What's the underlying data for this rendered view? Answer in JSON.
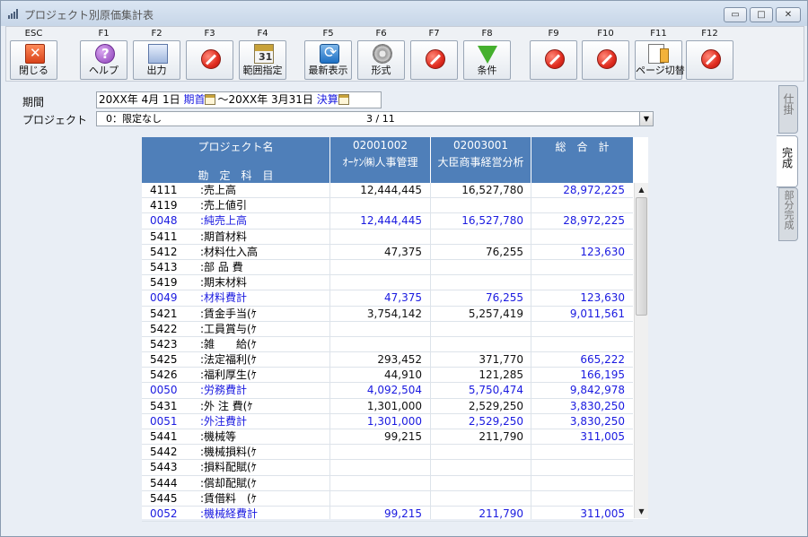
{
  "window": {
    "title": "プロジェクト別原価集計表"
  },
  "window_controls": {
    "minimize": "▭",
    "maximize": "□",
    "close": "✕"
  },
  "toolbar": [
    {
      "key": "ESC",
      "label": "閉じる",
      "icon": "close-icon"
    },
    {
      "key": "F1",
      "label": "ヘルプ",
      "icon": "help-icon"
    },
    {
      "key": "F2",
      "label": "出力",
      "icon": "print-icon"
    },
    {
      "key": "F3",
      "label": "",
      "icon": "stop-icon"
    },
    {
      "key": "F4",
      "label": "範囲指定",
      "icon": "calendar-icon"
    },
    {
      "key": "F5",
      "label": "最新表示",
      "icon": "refresh-icon"
    },
    {
      "key": "F6",
      "label": "形式",
      "icon": "gear-icon"
    },
    {
      "key": "F7",
      "label": "",
      "icon": "stop-icon"
    },
    {
      "key": "F8",
      "label": "条件",
      "icon": "filter-icon"
    },
    {
      "key": "F9",
      "label": "",
      "icon": "stop-icon"
    },
    {
      "key": "F10",
      "label": "",
      "icon": "stop-icon"
    },
    {
      "key": "F11",
      "label": "ページ切替",
      "icon": "page-icon"
    },
    {
      "key": "F12",
      "label": "",
      "icon": "stop-icon"
    }
  ],
  "filters": {
    "period_label": "期間",
    "period_start": "20XX年 4月 1日",
    "period_start_link": "期首",
    "period_sep": "～",
    "period_end": "20XX年 3月31日",
    "period_end_link": "決算",
    "project_label": "プロジェクト",
    "project_value": "0：限定なし",
    "project_count": "3 / 11"
  },
  "grid": {
    "header_name_top": "プロジェクト名",
    "header_name_bottom": "勘　定　科　目",
    "columns": [
      {
        "code": "02001002",
        "name": "ｵｰｹﾝ㈱人事管理"
      },
      {
        "code": "02003001",
        "name": "大臣商事経営分析"
      },
      {
        "code": "総　合　計",
        "name": ""
      }
    ],
    "rows": [
      {
        "code": "4111",
        "name": ":売上高",
        "c1": "12,444,445",
        "c2": "16,527,780",
        "total": "28,972,225",
        "subtotal": false
      },
      {
        "code": "4119",
        "name": ":売上値引",
        "c1": "",
        "c2": "",
        "total": "",
        "subtotal": false
      },
      {
        "code": "0048",
        "name": ":純売上高",
        "c1": "12,444,445",
        "c2": "16,527,780",
        "total": "28,972,225",
        "subtotal": true
      },
      {
        "code": "5411",
        "name": ":期首材料",
        "c1": "",
        "c2": "",
        "total": "",
        "subtotal": false
      },
      {
        "code": "5412",
        "name": ":材料仕入高",
        "c1": "47,375",
        "c2": "76,255",
        "total": "123,630",
        "subtotal": false
      },
      {
        "code": "5413",
        "name": ":部 品 費",
        "c1": "",
        "c2": "",
        "total": "",
        "subtotal": false
      },
      {
        "code": "5419",
        "name": ":期末材料",
        "c1": "",
        "c2": "",
        "total": "",
        "subtotal": false
      },
      {
        "code": "0049",
        "name": ":材料費計",
        "c1": "47,375",
        "c2": "76,255",
        "total": "123,630",
        "subtotal": true
      },
      {
        "code": "5421",
        "name": ":賃金手当(ｹ",
        "c1": "3,754,142",
        "c2": "5,257,419",
        "total": "9,011,561",
        "subtotal": false
      },
      {
        "code": "5422",
        "name": ":工員賞与(ｹ",
        "c1": "",
        "c2": "",
        "total": "",
        "subtotal": false
      },
      {
        "code": "5423",
        "name": ":雑　　給(ｹ",
        "c1": "",
        "c2": "",
        "total": "",
        "subtotal": false
      },
      {
        "code": "5425",
        "name": ":法定福利(ｹ",
        "c1": "293,452",
        "c2": "371,770",
        "total": "665,222",
        "subtotal": false
      },
      {
        "code": "5426",
        "name": ":福利厚生(ｹ",
        "c1": "44,910",
        "c2": "121,285",
        "total": "166,195",
        "subtotal": false
      },
      {
        "code": "0050",
        "name": ":労務費計",
        "c1": "4,092,504",
        "c2": "5,750,474",
        "total": "9,842,978",
        "subtotal": true
      },
      {
        "code": "5431",
        "name": ":外 注 費(ｹ",
        "c1": "1,301,000",
        "c2": "2,529,250",
        "total": "3,830,250",
        "subtotal": false
      },
      {
        "code": "0051",
        "name": ":外注費計",
        "c1": "1,301,000",
        "c2": "2,529,250",
        "total": "3,830,250",
        "subtotal": true
      },
      {
        "code": "5441",
        "name": ":機械等",
        "c1": "99,215",
        "c2": "211,790",
        "total": "311,005",
        "subtotal": false
      },
      {
        "code": "5442",
        "name": ":機械損料(ｹ",
        "c1": "",
        "c2": "",
        "total": "",
        "subtotal": false
      },
      {
        "code": "5443",
        "name": ":損料配賦(ｹ",
        "c1": "",
        "c2": "",
        "total": "",
        "subtotal": false
      },
      {
        "code": "5444",
        "name": ":償却配賦(ｹ",
        "c1": "",
        "c2": "",
        "total": "",
        "subtotal": false
      },
      {
        "code": "5445",
        "name": ":賃借料　(ｹ",
        "c1": "",
        "c2": "",
        "total": "",
        "subtotal": false
      },
      {
        "code": "0052",
        "name": ":機械経費計",
        "c1": "99,215",
        "c2": "211,790",
        "total": "311,005",
        "subtotal": true
      }
    ]
  },
  "side_tabs": [
    {
      "label": "仕掛",
      "active": false
    },
    {
      "label": "完成",
      "active": true
    },
    {
      "label": "部分完成",
      "active": false
    }
  ],
  "colors": {
    "header": "#4f7fb9",
    "subtotal_text": "#1a1ae0",
    "window_bg": "#e9eef5"
  }
}
